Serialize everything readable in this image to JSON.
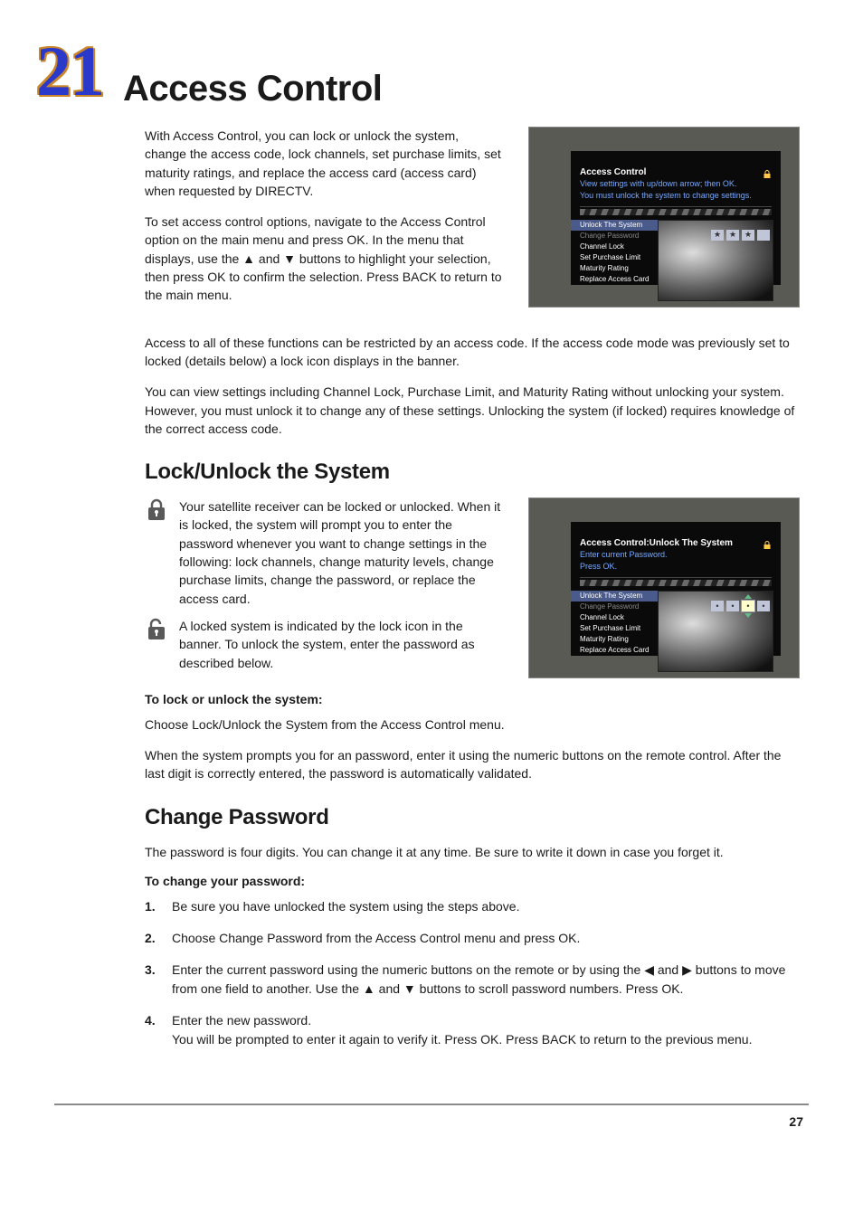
{
  "pageNumber": "21",
  "pageTitle": "Access Control",
  "footerPage": "27",
  "intro": {
    "p1": "With Access Control, you can lock or unlock the system, change the access code, lock channels, set purchase limits, set maturity ratings, and replace the access card (access card) when requested by DIRECTV.",
    "p2a": "To set access control options, navigate to the Access Control option on the main menu and press OK. In the menu that displays, use the ",
    "up": "▲",
    "and": " and ",
    "down": "▼",
    "p2b": " buttons to highlight your selection, then press OK to confirm the selection. Press BACK to return to the main menu."
  },
  "afterShot": {
    "p1": "Access to all of these functions can be restricted by an access code. If the access code mode was previously set to locked (details below) a lock icon displays in the banner.",
    "p2": "You can view settings including Channel Lock, Purchase Limit, and Maturity Rating without unlocking your system. However, you must unlock it to change any of these settings. Unlocking the system (if locked) requires knowledge of the correct access code."
  },
  "lockSection": {
    "heading": "Lock/Unlock the System",
    "p1": "Your satellite receiver can be locked or unlocked. When it is locked, the system will prompt you to enter the password whenever you want to change settings in the following: lock channels, change  maturity levels, change purchase limits, change the password, or replace the access card.",
    "p2": "A locked system is indicated by the lock icon in the banner. To unlock the system, enter the password as described below.",
    "procHeading": "To lock or unlock the system:",
    "proc1": "Choose Lock/Unlock the System from the Access Control menu.",
    "proc2": "When the system prompts you for an password, enter it using the numeric buttons on the remote control. After the last digit is correctly entered, the password is automatically validated."
  },
  "changePw": {
    "heading": "Change Password",
    "intro": "The password is four digits. You can change it at any time. Be sure to write it down in case you forget it.",
    "procHeading": "To change your password:",
    "steps": [
      {
        "n": "1",
        "text": "Be sure you have unlocked the system using the steps above."
      },
      {
        "n": "2",
        "text": "Choose Change Password from the Access Control menu and press OK."
      },
      {
        "n": "3",
        "a": "Enter the current password using the numeric buttons on the remote or by using the ",
        "left": "◀",
        "and": " and ",
        "right": "▶",
        "b": " buttons to move from one field to another. Use the ",
        "up": "▲",
        "and2": " and ",
        "down": "▼",
        "c": " buttons to scroll password numbers. Press OK."
      },
      {
        "n": "4",
        "a": "Enter the new password.",
        "b": "You will be prompted to enter it again to verify it. Press OK. Press BACK to return to the previous menu."
      }
    ]
  },
  "shot1": {
    "title": "Access Control",
    "sub1": "View settings with up/down arrow; then OK.",
    "sub2": "You must unlock the system to change settings.",
    "menu": [
      "Unlock The System",
      "Change Password",
      "Channel Lock",
      "Set Purchase Limit",
      "Maturity Rating",
      "Replace Access Card"
    ],
    "boxes": [
      "★",
      "★",
      "★",
      ""
    ]
  },
  "shot2": {
    "title": "Access Control:Unlock The System",
    "sub1": "Enter current Password.",
    "sub2": "Press OK.",
    "menu": [
      "Unlock The System",
      "Change Password",
      "Channel Lock",
      "Set Purchase Limit",
      "Maturity Rating",
      "Replace Access Card"
    ],
    "boxes": [
      "•",
      "•",
      "•",
      "•"
    ]
  }
}
